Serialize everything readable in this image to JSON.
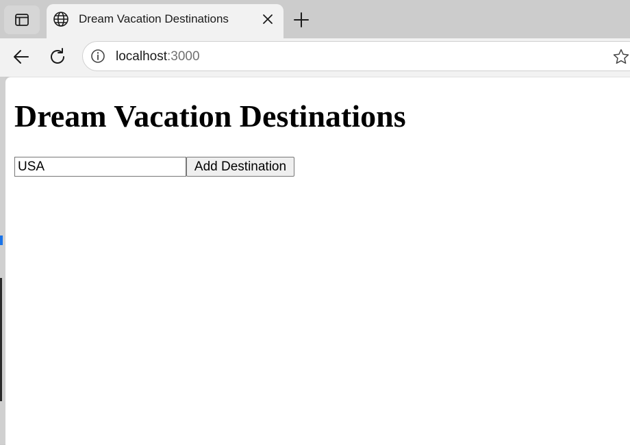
{
  "browser": {
    "tab": {
      "title": "Dream Vacation Destinations"
    },
    "address_bar": {
      "host": "localhost",
      "port": ":3000"
    },
    "icons": {
      "tab_actions": "tab-actions-icon",
      "favicon": "globe-icon",
      "close": "close-icon",
      "new_tab": "plus-icon",
      "back": "back-arrow-icon",
      "reload": "reload-icon",
      "site_info": "info-icon",
      "favorite": "star-icon"
    }
  },
  "page": {
    "heading": "Dream Vacation Destinations",
    "destination_input": {
      "value": "USA"
    },
    "add_button_label": "Add Destination"
  },
  "colors": {
    "accent": "#1a73e8",
    "tabstrip": "#cccccc",
    "toolbar": "#f2f2f2"
  }
}
